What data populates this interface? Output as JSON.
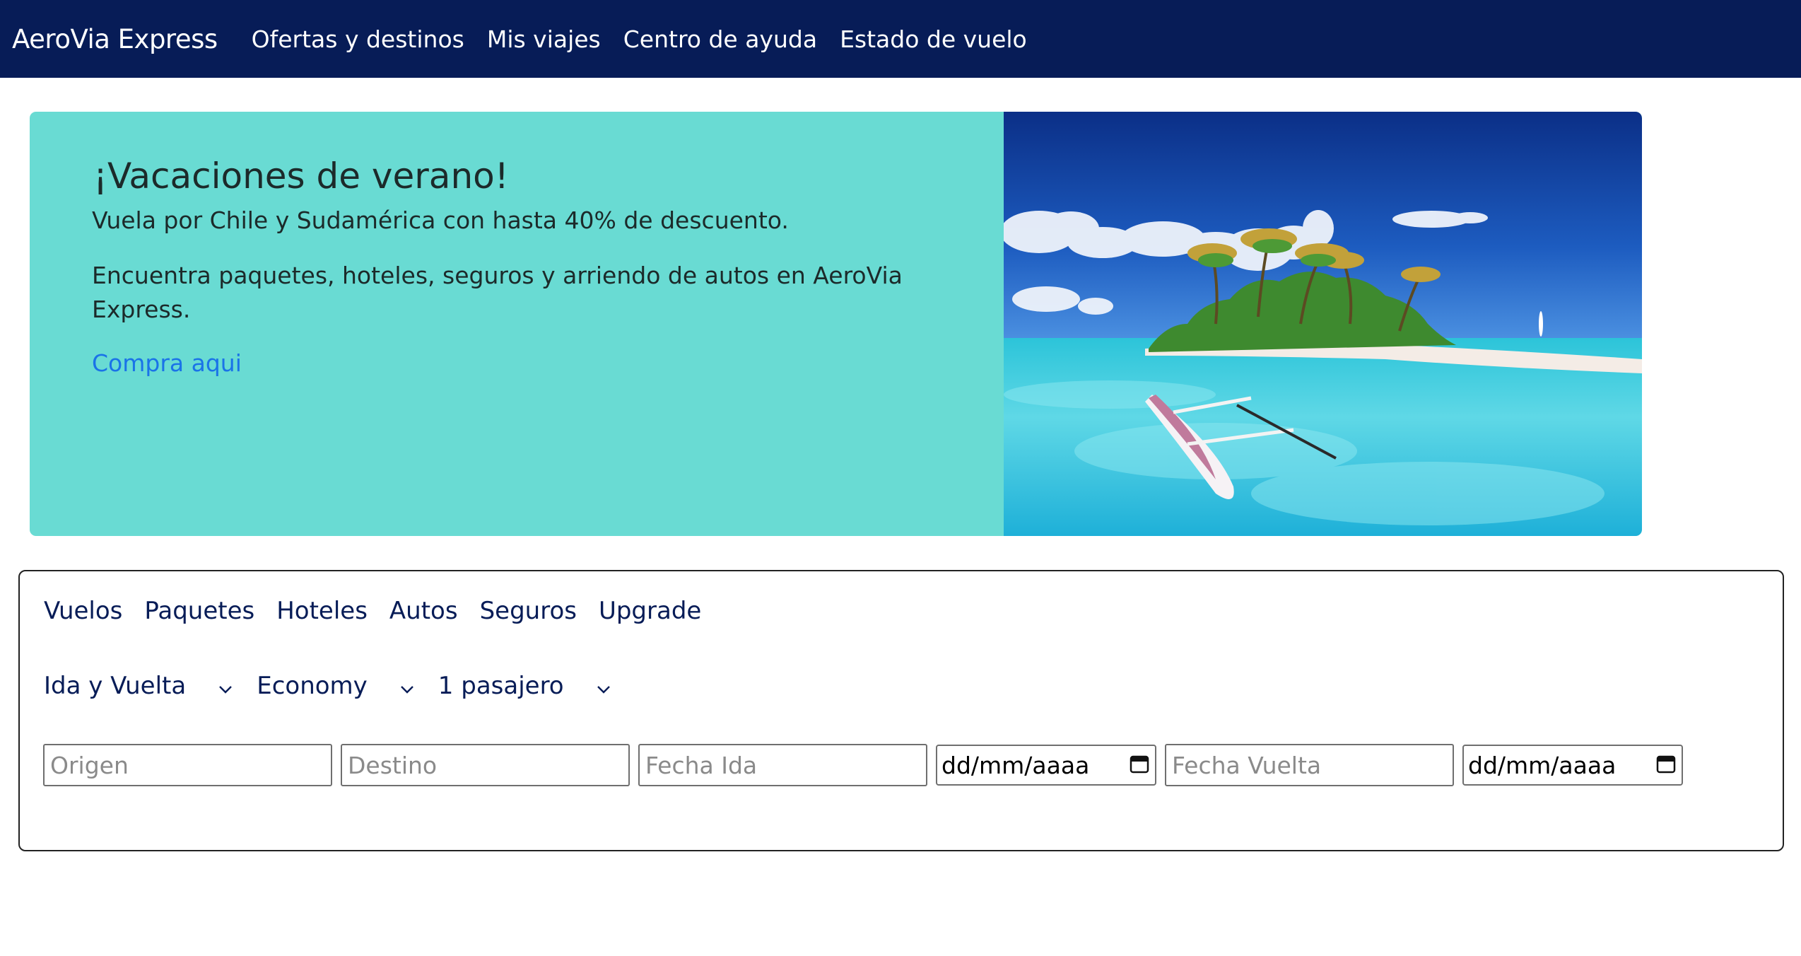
{
  "navbar": {
    "brand": "AeroVia Express",
    "links": [
      "Ofertas y destinos",
      "Mis viajes",
      "Centro de ayuda",
      "Estado de vuelo"
    ]
  },
  "hero": {
    "title": "¡Vacaciones de verano!",
    "subtitle": "Vuela por Chile y Sudamérica con hasta 40% de descuento.",
    "body": "Encuentra paquetes, hoteles, seguros y arriendo de autos en AeroVia Express.",
    "link": "Compra aqui",
    "background_color": "#69dbd3",
    "image_icon": "tropical-island-photo"
  },
  "search": {
    "tabs": [
      "Vuelos",
      "Paquetes",
      "Hoteles",
      "Autos",
      "Seguros",
      "Upgrade"
    ],
    "selectors": {
      "trip_type": "Ida y Vuelta",
      "cabin": "Economy",
      "passengers": "1 pasajero"
    },
    "fields": {
      "origin_placeholder": "Origen",
      "destination_placeholder": "Destino",
      "departure_label_placeholder": "Fecha Ida",
      "departure_date": "dd/mm/aaaa",
      "return_label_placeholder": "Fecha Vuelta",
      "return_date": "dd/mm/aaaa"
    }
  },
  "colors": {
    "navbar": "#071c57",
    "link": "#1a73e8",
    "tab_text": "#071c57"
  }
}
